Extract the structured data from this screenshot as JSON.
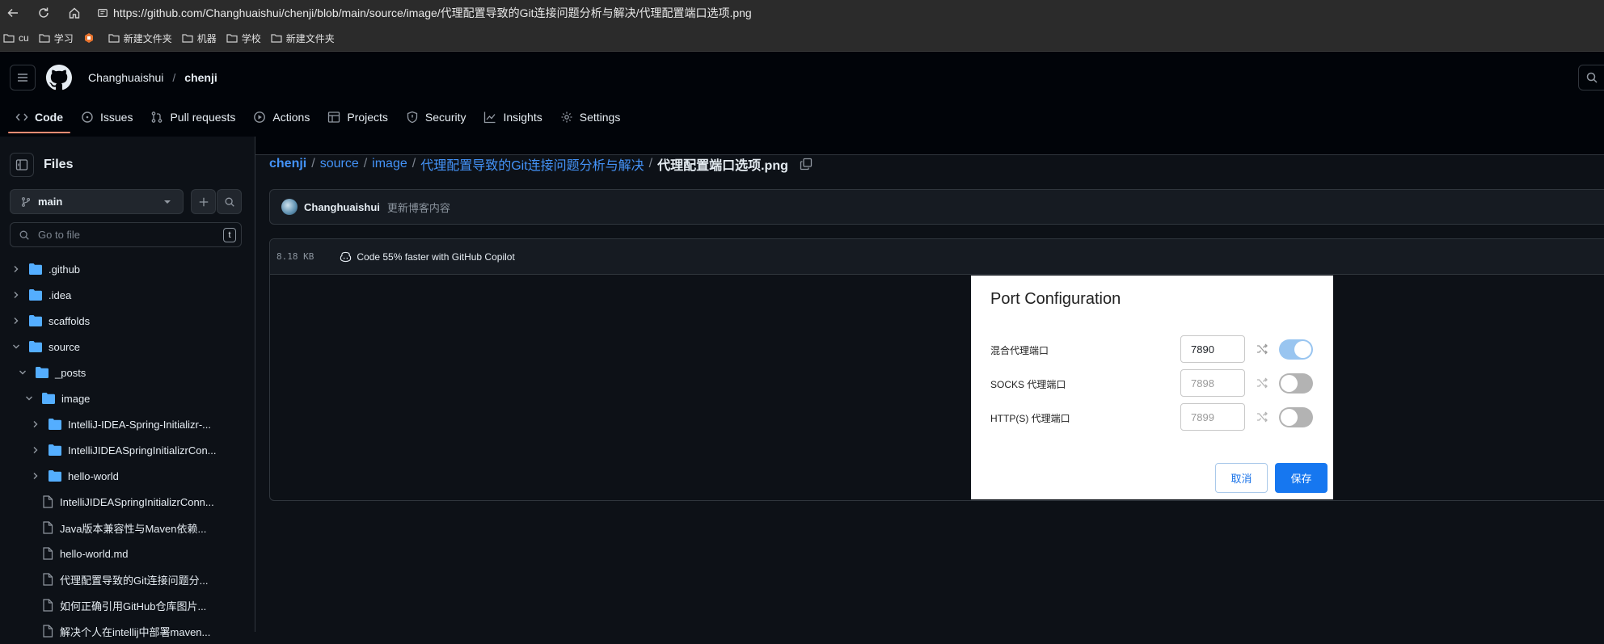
{
  "browser": {
    "url": "https://github.com/Changhuaishui/chenji/blob/main/source/image/代理配置导致的Git连接问题分析与解决/代理配置端口选项.png",
    "bookmarks": [
      "cu",
      "学习",
      "新建文件夹",
      "机器",
      "学校",
      "新建文件夹"
    ]
  },
  "header": {
    "owner": "Changhuaishui",
    "separator": "/",
    "repo": "chenji"
  },
  "tabs": [
    {
      "label": "Code",
      "icon": "code-icon"
    },
    {
      "label": "Issues",
      "icon": "issue-icon"
    },
    {
      "label": "Pull requests",
      "icon": "pull-request-icon"
    },
    {
      "label": "Actions",
      "icon": "play-icon"
    },
    {
      "label": "Projects",
      "icon": "table-icon"
    },
    {
      "label": "Security",
      "icon": "shield-icon"
    },
    {
      "label": "Insights",
      "icon": "graph-icon"
    },
    {
      "label": "Settings",
      "icon": "gear-icon"
    }
  ],
  "sidebar": {
    "title": "Files",
    "branch": "main",
    "search_placeholder": "Go to file",
    "search_shortcut": "t",
    "tree": [
      {
        "label": ".github",
        "type": "folder",
        "expanded": false
      },
      {
        "label": ".idea",
        "type": "folder",
        "expanded": false
      },
      {
        "label": "scaffolds",
        "type": "folder",
        "expanded": false
      },
      {
        "label": "source",
        "type": "folder",
        "expanded": true
      },
      {
        "label": "_posts",
        "type": "folder",
        "expanded": true
      },
      {
        "label": "image",
        "type": "folder",
        "expanded": true
      },
      {
        "label": "IntelliJ-IDEA-Spring-Initializr-...",
        "type": "folder",
        "expanded": false
      },
      {
        "label": "IntelliJIDEASpringInitializrCon...",
        "type": "folder",
        "expanded": false
      },
      {
        "label": "hello-world",
        "type": "folder",
        "expanded": false
      },
      {
        "label": "IntelliJIDEASpringInitializrConn...",
        "type": "file"
      },
      {
        "label": "Java版本兼容性与Maven依赖...",
        "type": "file"
      },
      {
        "label": "hello-world.md",
        "type": "file"
      },
      {
        "label": "代理配置导致的Git连接问题分...",
        "type": "file"
      },
      {
        "label": "如何正确引用GitHub仓库图片...",
        "type": "file"
      },
      {
        "label": "解决个人在intellij中部署maven...",
        "type": "file"
      }
    ]
  },
  "breadcrumb": {
    "root": "chenji",
    "parts": [
      "source",
      "image",
      "代理配置导致的Git连接问题分析与解决"
    ],
    "current": "代理配置端口选项.png"
  },
  "commit": {
    "author": "Changhuaishui",
    "message": "更新博客内容"
  },
  "file": {
    "size": "8.18 KB",
    "copilot_text": "Code 55% faster with GitHub Copilot"
  },
  "dialog": {
    "title": "Port Configuration",
    "rows": [
      {
        "label": "混合代理端口",
        "value": "7890",
        "enabled": true
      },
      {
        "label": "SOCKS 代理端口",
        "value": "7898",
        "enabled": false
      },
      {
        "label": "HTTP(S) 代理端口",
        "value": "7899",
        "enabled": false
      }
    ],
    "cancel_label": "取消",
    "save_label": "保存"
  },
  "colors": {
    "accent_link": "#4493f8",
    "tab_underline": "#fd8c73",
    "folder": "#54aeff",
    "save_button": "#1677f0",
    "toggle_on": "#99c5f0"
  }
}
